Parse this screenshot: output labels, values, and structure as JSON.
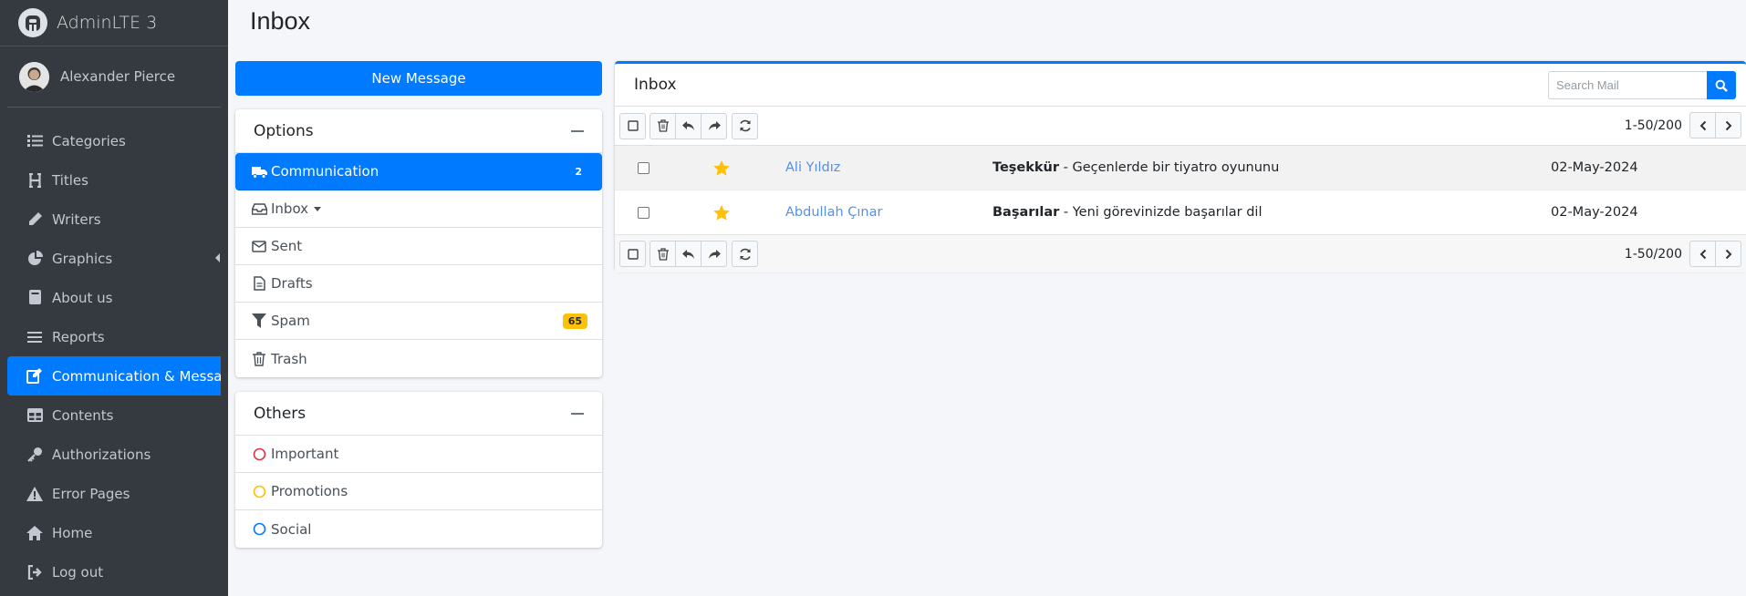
{
  "brand": {
    "name": "AdminLTE 3"
  },
  "user": {
    "name": "Alexander Pierce"
  },
  "nav": [
    {
      "label": "Categories",
      "icon": "list-icon"
    },
    {
      "label": "Titles",
      "icon": "heading-icon"
    },
    {
      "label": "Writers",
      "icon": "pencil-icon"
    },
    {
      "label": "Graphics",
      "icon": "pie-chart-icon"
    },
    {
      "label": "About us",
      "icon": "book-icon"
    },
    {
      "label": "Reports",
      "icon": "bars-icon"
    },
    {
      "label": "Communication & Messages",
      "icon": "edit-icon",
      "active": true
    },
    {
      "label": "Contents",
      "icon": "table-icon"
    },
    {
      "label": "Authorizations",
      "icon": "key-icon"
    },
    {
      "label": "Error Pages",
      "icon": "warning-icon"
    },
    {
      "label": "Home",
      "icon": "home-icon"
    },
    {
      "label": "Log out",
      "icon": "sign-out-icon"
    }
  ],
  "page": {
    "title": "Inbox"
  },
  "compose": {
    "label": "New Message"
  },
  "options": {
    "title": "Options",
    "folders": [
      {
        "label": "Communication",
        "badge": "2",
        "icon": "truck-icon"
      },
      {
        "label": "Inbox",
        "icon": "inbox-icon"
      },
      {
        "label": "Sent",
        "icon": "envelope-icon"
      },
      {
        "label": "Drafts",
        "icon": "file-icon"
      },
      {
        "label": "Spam",
        "badge": "65",
        "icon": "filter-icon"
      },
      {
        "label": "Trash",
        "icon": "trash-icon"
      }
    ]
  },
  "others": {
    "title": "Others",
    "labels": [
      {
        "label": "Important",
        "color": "#dc3545"
      },
      {
        "label": "Promotions",
        "color": "#ffc107"
      },
      {
        "label": "Social",
        "color": "#007bff"
      }
    ]
  },
  "mailbox": {
    "title": "Inbox",
    "search_placeholder": "Search Mail",
    "pager_top": "1-50/200",
    "pager_bottom": "1-50/200",
    "messages": [
      {
        "sender": "Ali Yıldız",
        "subject": "Teşekkür",
        "preview": " - Geçenlerde bir tiyatro oyununu",
        "date": "02-May-2024"
      },
      {
        "sender": "Abdullah Çınar",
        "subject": "Başarılar",
        "preview": " - Yeni görevinizde başarılar dil",
        "date": "02-May-2024"
      }
    ]
  },
  "colors": {
    "primary": "#007bff",
    "sidebar": "#343a40",
    "warning": "#ffc107"
  }
}
